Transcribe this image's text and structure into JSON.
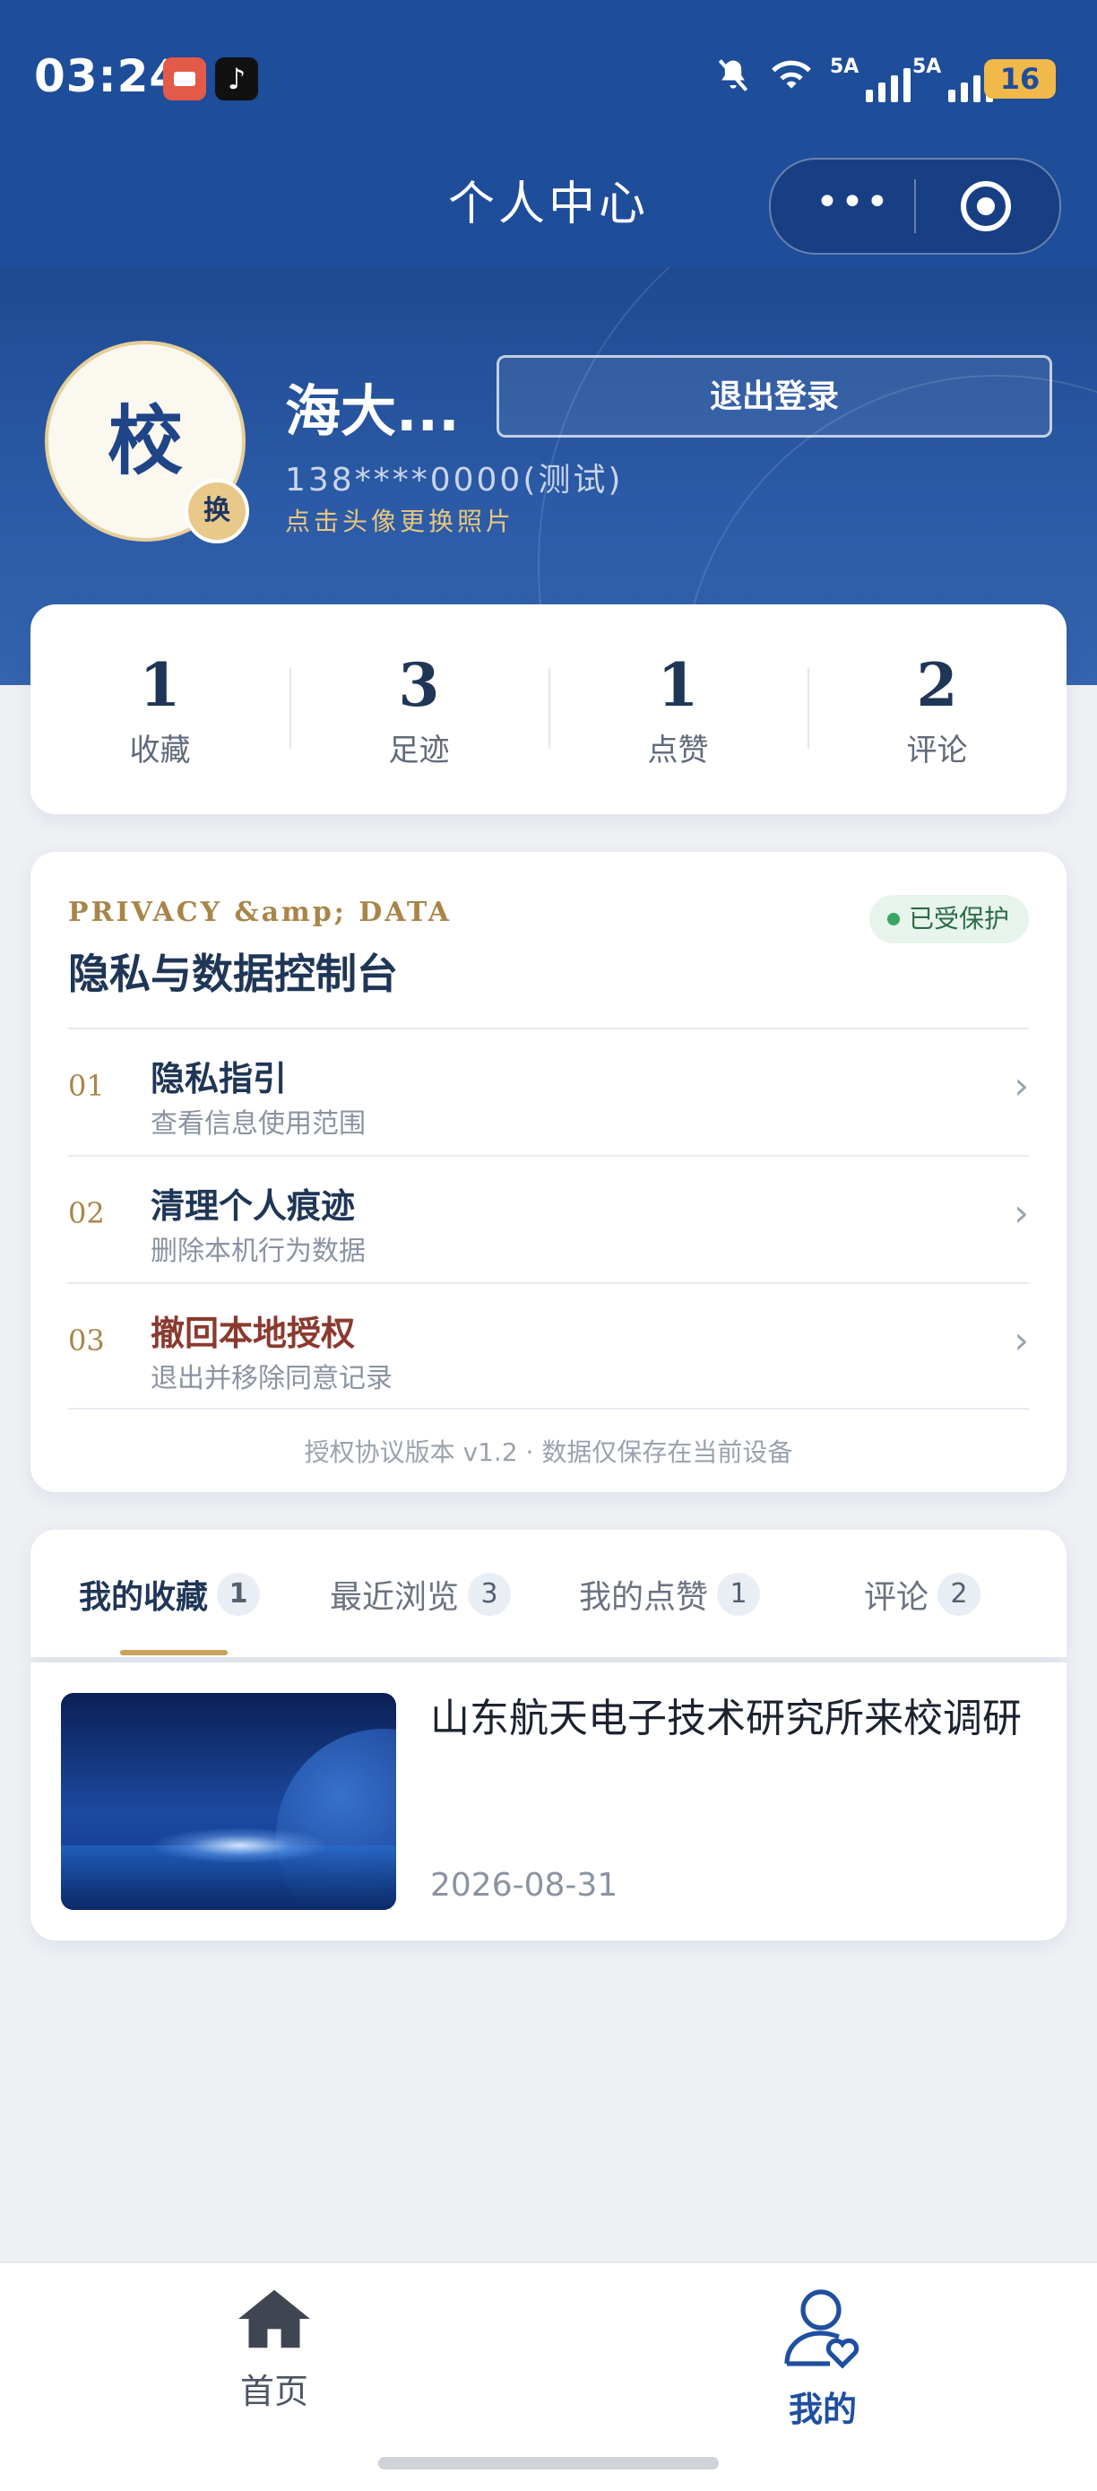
{
  "status_bar": {
    "time": "03:24",
    "battery": "16",
    "network_1": "5A",
    "network_2": "5A",
    "wifi_label": "6"
  },
  "nav": {
    "title": "个人中心"
  },
  "profile": {
    "avatar_text": "校",
    "swap_label": "换",
    "name": "海大...",
    "phone": "138****0000(测试)",
    "hint": "点击头像更换照片",
    "logout_label": "退出登录"
  },
  "stats": [
    {
      "value": "1",
      "label": "收藏"
    },
    {
      "value": "3",
      "label": "足迹"
    },
    {
      "value": "1",
      "label": "点赞"
    },
    {
      "value": "2",
      "label": "评论"
    }
  ],
  "privacy": {
    "kicker": "PRIVACY &amp; DATA",
    "title": "隐私与数据控制台",
    "badge": "已受保护",
    "items": [
      {
        "index": "01",
        "title": "隐私指引",
        "subtitle": "查看信息使用范围"
      },
      {
        "index": "02",
        "title": "清理个人痕迹",
        "subtitle": "删除本机行为数据"
      },
      {
        "index": "03",
        "title": "撤回本地授权",
        "subtitle": "退出并移除同意记录"
      }
    ],
    "footer": "授权协议版本 v1.2 · 数据仅保存在当前设备"
  },
  "tabs": [
    {
      "label": "我的收藏",
      "count": "1",
      "active": true
    },
    {
      "label": "最近浏览",
      "count": "3",
      "active": false
    },
    {
      "label": "我的点赞",
      "count": "1",
      "active": false
    },
    {
      "label": "评论",
      "count": "2",
      "active": false
    }
  ],
  "article": {
    "title": "山东航天电子技术研究所来校调研",
    "date": "2026-08-31"
  },
  "tabbar": {
    "home": "首页",
    "me": "我的"
  },
  "colors": {
    "primary": "#1e4d9a",
    "gold": "#c9a25c",
    "danger": "#8b3a2f",
    "success": "#3aa465"
  }
}
